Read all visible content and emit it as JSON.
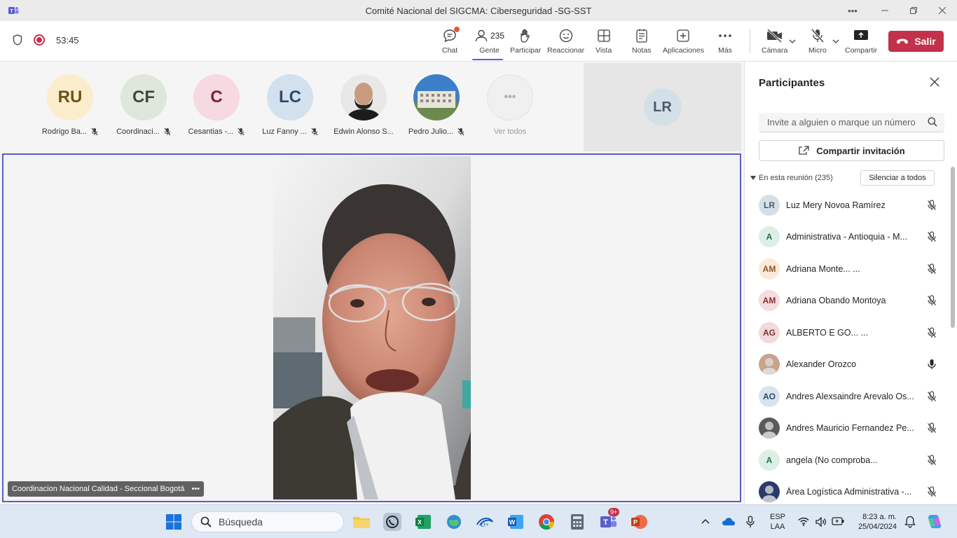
{
  "window": {
    "title": "Comité Nacional del SIGCMA: Ciberseguridad -SG-SST"
  },
  "toolbar": {
    "timer": "53:45",
    "buttons": [
      {
        "id": "chat",
        "label": "Chat"
      },
      {
        "id": "people",
        "label": "Gente",
        "count": "235"
      },
      {
        "id": "raise",
        "label": "Participar"
      },
      {
        "id": "react",
        "label": "Reaccionar"
      },
      {
        "id": "view",
        "label": "Vista"
      },
      {
        "id": "notes",
        "label": "Notas"
      },
      {
        "id": "apps",
        "label": "Aplicaciones"
      },
      {
        "id": "more",
        "label": "Más"
      },
      {
        "id": "camera",
        "label": "Cámara"
      },
      {
        "id": "mic",
        "label": "Micro"
      },
      {
        "id": "share",
        "label": "Compartir"
      }
    ],
    "leave_label": "Salir"
  },
  "strip": {
    "tiles": [
      {
        "initials": "RU",
        "name": "Rodrigo Ba...",
        "bg": "#fbeccb",
        "fg": "#6b5416"
      },
      {
        "initials": "CF",
        "name": "Coordinaci...",
        "bg": "#dfe6dc",
        "fg": "#3c4a37"
      },
      {
        "initials": "C",
        "name": "Cesantias -...",
        "bg": "#f6d9e1",
        "fg": "#7a2140"
      },
      {
        "initials": "LC",
        "name": "Luz Fanny ...",
        "bg": "#d3e0ee",
        "fg": "#2f4a6a"
      },
      {
        "initials": "",
        "name": "Edwin Alonso S...",
        "photo": true
      },
      {
        "initials": "",
        "name": "Pedro Julio...",
        "photo": true
      }
    ],
    "see_all_label": "Ver todos",
    "pinned_initials": "LR"
  },
  "speaker": {
    "label": "Coordinacion Nacional Calidad - Seccional Bogotá"
  },
  "panel": {
    "title": "Participantes",
    "search_placeholder": "Invite a alguien o marque un número",
    "share_invite_label": "Compartir invitación",
    "section_label": "En esta reunión (235)",
    "mute_all_label": "Silenciar a todos",
    "participants": [
      {
        "initials": "LR",
        "name": "Luz Mery Novoa Ramírez",
        "bg": "#d3e0e8",
        "fg": "#4a5a66",
        "mic": "muted"
      },
      {
        "initials": "A",
        "name": "Administrativa - Antioquia - M...",
        "bg": "#dbefe4",
        "fg": "#2c6a47",
        "mic": "muted"
      },
      {
        "initials": "AM",
        "name": "Adriana Monte...  ...",
        "bg": "#fbe8d6",
        "fg": "#8a5a25",
        "mic": "muted"
      },
      {
        "initials": "AM",
        "name": "Adriana Obando Montoya",
        "bg": "#f6dcdc",
        "fg": "#8a3030",
        "mic": "muted"
      },
      {
        "initials": "AG",
        "name": "ALBERTO E GO...  ...",
        "bg": "#f3d9d9",
        "fg": "#7a3535",
        "mic": "muted"
      },
      {
        "initials": "",
        "name": "Alexander Orozco",
        "photo": true,
        "mic": "on"
      },
      {
        "initials": "AO",
        "name": "Andres Alexsaindre Arevalo Os...",
        "bg": "#d9e3ee",
        "fg": "#2f4a6a",
        "mic": "muted"
      },
      {
        "initials": "",
        "name": "Andres Mauricio Fernandez Pe...",
        "photo": true,
        "mic": "muted"
      },
      {
        "initials": "A",
        "name": "angela (No comproba...",
        "bg": "#dbefe4",
        "fg": "#2c6a47",
        "mic": "muted"
      },
      {
        "initials": "",
        "name": "Área Logística Administrativa -...",
        "photo": true,
        "mic": "muted"
      }
    ]
  },
  "taskbar": {
    "search_placeholder": "Búsqueda",
    "lang_top": "ESP",
    "lang_bottom": "LAA",
    "time": "8:23 a. m.",
    "date": "25/04/2024",
    "teams_badge": "9+"
  },
  "colors": {
    "accent": "#5b5fc7",
    "leave": "#c4314b"
  }
}
